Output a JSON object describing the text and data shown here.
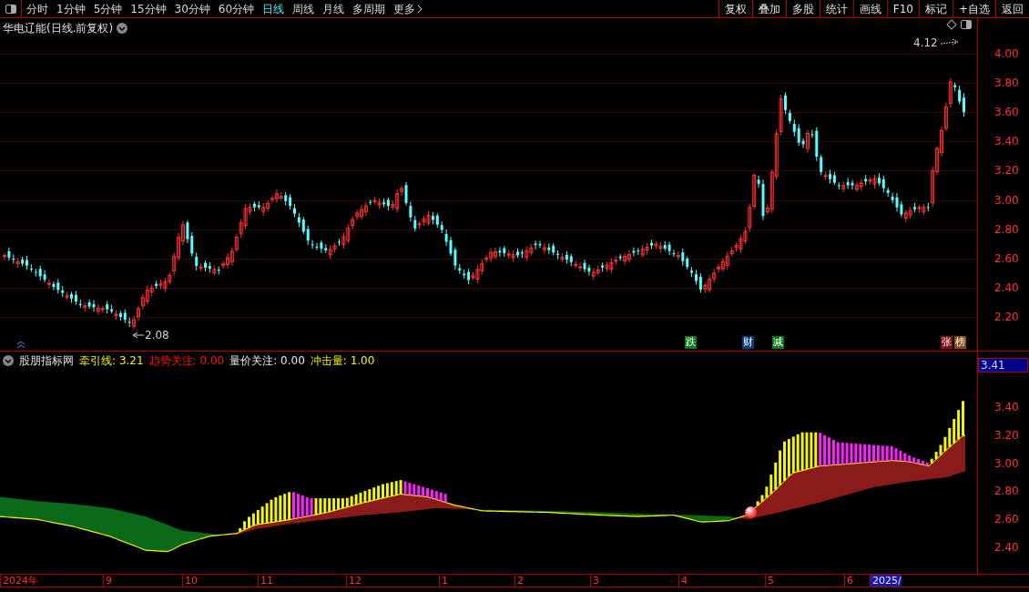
{
  "toolbar": {
    "periods": [
      {
        "label": "分时",
        "selected": false
      },
      {
        "label": "1分钟",
        "selected": false
      },
      {
        "label": "5分钟",
        "selected": false
      },
      {
        "label": "15分钟",
        "selected": false
      },
      {
        "label": "30分钟",
        "selected": false
      },
      {
        "label": "60分钟",
        "selected": false
      },
      {
        "label": "日线",
        "selected": true
      },
      {
        "label": "周线",
        "selected": false
      },
      {
        "label": "月线",
        "selected": false
      },
      {
        "label": "多周期",
        "selected": false
      },
      {
        "label": "更多",
        "selected": false
      }
    ],
    "buttons": [
      "复权",
      "叠加",
      "多股",
      "统计",
      "画线",
      "F10",
      "标记",
      "+自选",
      "返回"
    ]
  },
  "main_chart": {
    "title": "华电辽能(日线.前复权)",
    "high_label": "4.12",
    "low_label": "2.08",
    "yticks": [
      "4.00",
      "3.80",
      "3.60",
      "3.40",
      "3.20",
      "3.00",
      "2.80",
      "2.60",
      "2.40",
      "2.20"
    ],
    "event_tags": [
      {
        "label": "跌",
        "color": "#0a7a1a"
      },
      {
        "label": "财",
        "color": "#0d3f7a"
      },
      {
        "label": "减",
        "color": "#0a7a1a"
      },
      {
        "label": "张",
        "color": "#8a0d0d"
      },
      {
        "label": "榜",
        "color": "#8a4a10"
      }
    ]
  },
  "indicator": {
    "name": "股朋指标网",
    "legend": [
      {
        "label": "牵引线:",
        "value": "3.21",
        "color": "#f5f50a"
      },
      {
        "label": "趋势关注:",
        "value": "0.00",
        "color": "#ff1010"
      },
      {
        "label": "量价关注:",
        "value": "0.00",
        "color": "#e8e8e8"
      },
      {
        "label": "冲击量:",
        "value": "1.00",
        "color": "#f5f50a"
      }
    ],
    "current_value": "3.41",
    "yticks": [
      "3.40",
      "3.20",
      "3.00",
      "2.80",
      "2.60",
      "2.40"
    ]
  },
  "date_axis": [
    {
      "label": "2024年",
      "highlighted": false
    },
    {
      "label": "9",
      "highlighted": false
    },
    {
      "label": "10",
      "highlighted": false
    },
    {
      "label": "11",
      "highlighted": false
    },
    {
      "label": "12",
      "highlighted": false
    },
    {
      "label": "1",
      "highlighted": false
    },
    {
      "label": "2",
      "highlighted": false
    },
    {
      "label": "3",
      "highlighted": false
    },
    {
      "label": "4",
      "highlighted": false
    },
    {
      "label": "5",
      "highlighted": false
    },
    {
      "label": "6",
      "highlighted": false
    },
    {
      "label": "2025/",
      "highlighted": true
    }
  ]
}
